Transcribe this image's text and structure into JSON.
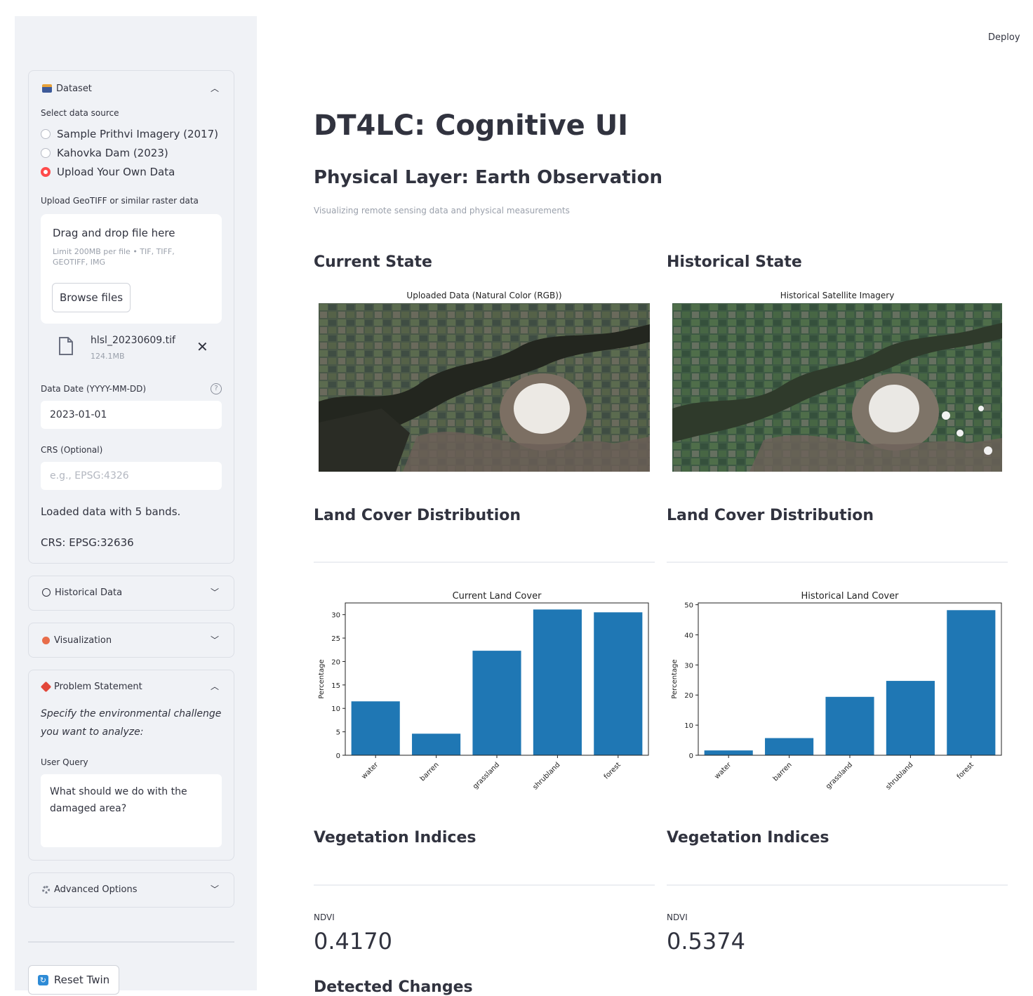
{
  "header": {
    "deploy_label": "Deploy"
  },
  "sidebar": {
    "dataset": {
      "title": "Dataset",
      "source_label": "Select data source",
      "options": [
        "Sample Prithvi Imagery (2017)",
        "Kahovka Dam (2023)",
        "Upload Your Own Data"
      ],
      "selected_option": "Upload Your Own Data",
      "upload_label": "Upload GeoTIFF or similar raster data",
      "dropzone_title": "Drag and drop file here",
      "dropzone_limit": "Limit 200MB per file • TIF, TIFF, GEOTIFF, IMG",
      "browse_label": "Browse files",
      "file_name": "hlsl_20230609.tif",
      "file_size": "124.1MB",
      "date_label": "Data Date (YYYY-MM-DD)",
      "date_value": "2023-01-01",
      "crs_label": "CRS (Optional)",
      "crs_placeholder": "e.g., EPSG:4326",
      "loaded_text": "Loaded data with 5 bands.",
      "crs_text": "CRS: EPSG:32636"
    },
    "historical": {
      "title": "Historical Data"
    },
    "visualization": {
      "title": "Visualization"
    },
    "problem": {
      "title": "Problem Statement",
      "instruction": "Specify the environmental challenge you want to analyze:",
      "query_label": "User Query",
      "query_value": "What should we do with the damaged area?"
    },
    "advanced": {
      "title": "Advanced Options"
    },
    "reset_label": "Reset Twin"
  },
  "main": {
    "title": "DT4LC: Cognitive UI",
    "section_title": "Physical Layer: Earth Observation",
    "section_caption": "Visualizing remote sensing data and physical measurements",
    "current": {
      "heading": "Current State",
      "image_title": "Uploaded Data (Natural Color (RGB))",
      "landcover_heading": "Land Cover Distribution",
      "veg_heading": "Vegetation Indices",
      "ndvi_label": "NDVI",
      "ndvi_value": "0.4170"
    },
    "historical": {
      "heading": "Historical State",
      "image_title": "Historical Satellite Imagery",
      "landcover_heading": "Land Cover Distribution",
      "veg_heading": "Vegetation Indices",
      "ndvi_label": "NDVI",
      "ndvi_value": "0.5374"
    },
    "next_heading": "Detected Changes"
  },
  "colors": {
    "accent": "#ff4b4b",
    "bar": "#1f77b4",
    "sidebar_bg": "#f0f2f6"
  },
  "chart_data": [
    {
      "type": "bar",
      "title": "Current Land Cover",
      "ylabel": "Percentage",
      "categories": [
        "water",
        "barren",
        "grassland",
        "shrubland",
        "forest"
      ],
      "values": [
        11.5,
        4.6,
        22.3,
        31.1,
        30.5
      ],
      "ylim": [
        0,
        32.5
      ],
      "yticks": [
        0,
        5,
        10,
        15,
        20,
        25,
        30
      ]
    },
    {
      "type": "bar",
      "title": "Historical Land Cover",
      "ylabel": "Percentage",
      "categories": [
        "water",
        "barren",
        "grassland",
        "shrubland",
        "forest"
      ],
      "values": [
        1.6,
        5.7,
        19.4,
        24.7,
        48.2
      ],
      "ylim": [
        0,
        50.6
      ],
      "yticks": [
        0,
        10,
        20,
        30,
        40,
        50
      ]
    }
  ]
}
